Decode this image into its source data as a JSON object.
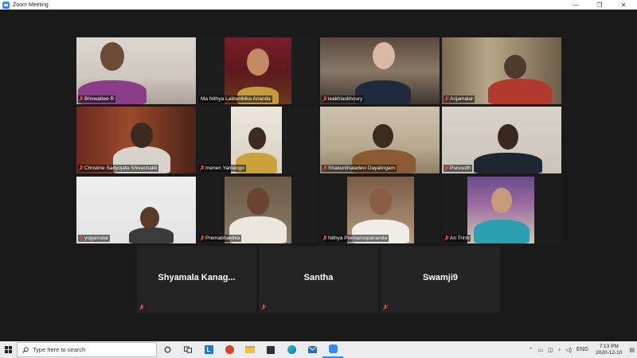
{
  "window": {
    "title": "Zoom Meeting",
    "controls": {
      "minimize": "—",
      "maximize": "❐",
      "close": "✕"
    }
  },
  "participants": [
    {
      "name": "Bhowattee R",
      "muted": true
    },
    {
      "name": "Ma Nithya Lalitambika Ananda",
      "muted": false,
      "active_speaker": true
    },
    {
      "name": "leakhlaskhoury",
      "muted": true
    },
    {
      "name": "Arijamalar",
      "muted": true
    },
    {
      "name": "Christine Sadyojata Shivashakti",
      "muted": true
    },
    {
      "name": "menen Yameogo",
      "muted": true
    },
    {
      "name": "Shakunthaladevi Dayalingam",
      "muted": true
    },
    {
      "name": "Purusoth",
      "muted": true
    },
    {
      "name": "yogamalar",
      "muted": true
    },
    {
      "name": "Premabhaktika",
      "muted": true
    },
    {
      "name": "Nithya Premaroopananda",
      "muted": true
    },
    {
      "name": "An Trinh",
      "muted": true
    },
    {
      "name": "Shyamala  Kanag...",
      "muted": true,
      "video_off": true
    },
    {
      "name": "Santha",
      "muted": true,
      "video_off": true
    },
    {
      "name": "Swamji9",
      "muted": true,
      "video_off": true
    }
  ],
  "taskbar": {
    "search_placeholder": "Type here to search",
    "pinned_icons": [
      "task-view-icon",
      "widgets-icon",
      "learning-tools-icon",
      "powerpoint-icon",
      "file-explorer-icon",
      "store-icon",
      "edge-icon",
      "mail-icon",
      "zoom-icon"
    ],
    "tray": {
      "language": "ENG",
      "time": "7:13 PM",
      "date": "2020-12-10"
    }
  },
  "colors": {
    "active_speaker_border": "#b9d14b",
    "muted_icon": "#e5493a",
    "zoom_blue": "#2d8cff"
  }
}
